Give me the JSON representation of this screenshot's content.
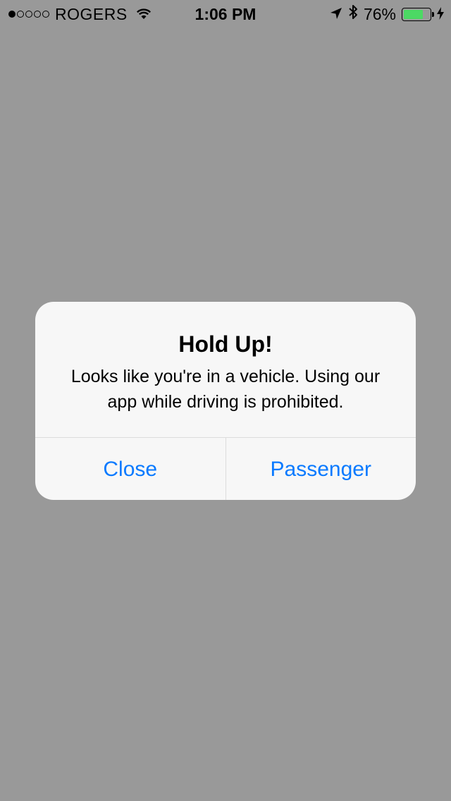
{
  "status_bar": {
    "signal_bars_filled": 1,
    "signal_bars_total": 5,
    "carrier": "ROGERS",
    "time": "1:06 PM",
    "battery_percent_label": "76%",
    "battery_level": 0.76,
    "icons": [
      "wifi-icon",
      "location-arrow-icon",
      "bluetooth-icon",
      "battery-icon",
      "charging-bolt-icon"
    ]
  },
  "alert": {
    "title": "Hold Up!",
    "message": "Looks like you're in a vehicle. Using our app while driving is prohibited.",
    "buttons": {
      "close_label": "Close",
      "passenger_label": "Passenger"
    }
  },
  "colors": {
    "background": "#999999",
    "alert_background": "#f7f7f7",
    "button_text": "#0a7aff",
    "battery_fill": "#4cd964"
  }
}
